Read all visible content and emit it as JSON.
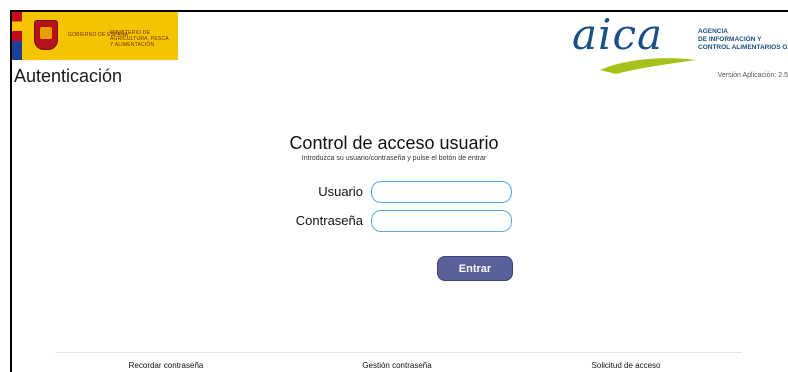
{
  "header": {
    "gov_line1": "GOBIERNO DE ESPAÑA",
    "gov_line2": "MINISTERIO DE AGRICULTURA, PESCA Y ALIMENTACIÓN",
    "page_title": "Autenticación",
    "aica_word": "aica",
    "aica_org": "AGENCIA\nDE INFORMACIÓN Y\nCONTROL ALIMENTARIOS O.",
    "version": "Versión Aplicación: 2.5"
  },
  "login": {
    "title": "Control de acceso usuario",
    "subtitle": "Introduzca su usuario/contraseña y pulse el botón de entrar",
    "user_label": "Usuario",
    "pass_label": "Contraseña",
    "user_value": "",
    "pass_value": "",
    "submit_label": "Entrar"
  },
  "footer": {
    "links": [
      "Recordar contraseña",
      "Gestión contraseña",
      "Solicitud de acceso"
    ]
  },
  "colors": {
    "gov_yellow": "#f6c300",
    "aica_blue": "#1b4f86",
    "aica_green": "#a6c21a",
    "button": "#5a6199",
    "input_border": "#5aa8de"
  }
}
